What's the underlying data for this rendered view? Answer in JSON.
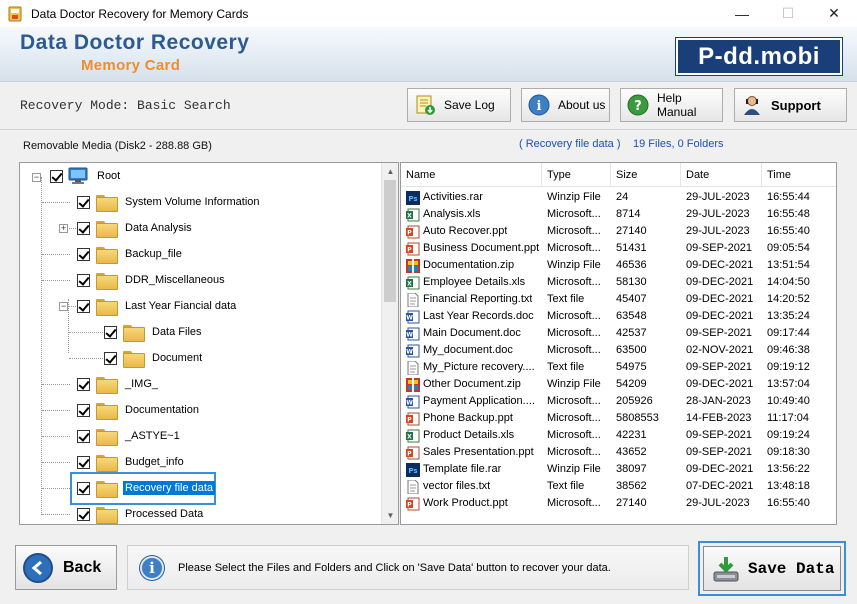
{
  "window": {
    "title": "Data Doctor Recovery for Memory Cards",
    "minimize": "—",
    "maximize": "☐",
    "close": "✕"
  },
  "header": {
    "brand_line1": "Data Doctor Recovery",
    "brand_line2": "Memory Card",
    "logo_text": "P-dd.mobi",
    "colors": {
      "brand_blue": "#2d5a8f",
      "brand_orange": "#f08c2e",
      "logo_bg": "#1a3f78"
    }
  },
  "toolbar": {
    "mode_text": "Recovery Mode: Basic Search",
    "buttons": [
      {
        "label": "Save Log",
        "icon": "save-log-icon"
      },
      {
        "label": "About us",
        "icon": "info-icon"
      },
      {
        "label": "Help Manual",
        "icon": "help-icon"
      },
      {
        "label": "Support",
        "icon": "support-person-icon"
      }
    ]
  },
  "left_panel": {
    "media_label": "Removable Media (Disk2 - 288.88 GB)",
    "tree": [
      {
        "label": "Root",
        "checked": true,
        "icon": "computer-icon"
      },
      {
        "label": "System Volume Information",
        "checked": true
      },
      {
        "label": "Data Analysis",
        "checked": true,
        "expandable": true
      },
      {
        "label": "Backup_file",
        "checked": true
      },
      {
        "label": "DDR_Miscellaneous",
        "checked": true
      },
      {
        "label": "Last Year Fiancial data",
        "checked": true,
        "expanded": true
      },
      {
        "label": "Data Files",
        "checked": true
      },
      {
        "label": "Document",
        "checked": true
      },
      {
        "label": "_IMG_",
        "checked": true
      },
      {
        "label": "Documentation",
        "checked": true
      },
      {
        "label": "_ASTYE~1",
        "checked": true
      },
      {
        "label": "Budget_info",
        "checked": true
      },
      {
        "label": "Recovery file data",
        "checked": true,
        "selected": true
      },
      {
        "label": "Processed Data",
        "checked": true
      }
    ]
  },
  "right_panel": {
    "title": "( Recovery file data )",
    "count": "19 Files, 0 Folders",
    "columns": [
      "Name",
      "Type",
      "Size",
      "Date",
      "Time"
    ],
    "rows": [
      {
        "name": "Activities.rar",
        "type": "Winzip File",
        "size": "24",
        "date": "29-JUL-2023",
        "time": "16:55:44",
        "icon": "ps"
      },
      {
        "name": "Analysis.xls",
        "type": "Microsoft...",
        "size": "8714",
        "date": "29-JUL-2023",
        "time": "16:55:48",
        "icon": "xls"
      },
      {
        "name": "Auto Recover.ppt",
        "type": "Microsoft...",
        "size": "27140",
        "date": "29-JUL-2023",
        "time": "16:55:40",
        "icon": "ppt"
      },
      {
        "name": "Business Document.ppt",
        "type": "Microsoft...",
        "size": "51431",
        "date": "09-SEP-2021",
        "time": "09:05:54",
        "icon": "ppt"
      },
      {
        "name": "Documentation.zip",
        "type": "Winzip File",
        "size": "46536",
        "date": "09-DEC-2021",
        "time": "13:51:54",
        "icon": "zip"
      },
      {
        "name": "Employee Details.xls",
        "type": "Microsoft...",
        "size": "58130",
        "date": "09-DEC-2021",
        "time": "14:04:50",
        "icon": "xls"
      },
      {
        "name": "Financial Reporting.txt",
        "type": "Text file",
        "size": "45407",
        "date": "09-DEC-2021",
        "time": "14:20:52",
        "icon": "txt"
      },
      {
        "name": "Last Year Records.doc",
        "type": "Microsoft...",
        "size": "63548",
        "date": "09-DEC-2021",
        "time": "13:35:24",
        "icon": "doc"
      },
      {
        "name": "Main Document.doc",
        "type": "Microsoft...",
        "size": "42537",
        "date": "09-SEP-2021",
        "time": "09:17:44",
        "icon": "doc"
      },
      {
        "name": "My_document.doc",
        "type": "Microsoft...",
        "size": "63500",
        "date": "02-NOV-2021",
        "time": "09:46:38",
        "icon": "doc"
      },
      {
        "name": "My_Picture recovery....",
        "type": "Text file",
        "size": "54975",
        "date": "09-SEP-2021",
        "time": "09:19:12",
        "icon": "txt"
      },
      {
        "name": "Other Document.zip",
        "type": "Winzip File",
        "size": "54209",
        "date": "09-DEC-2021",
        "time": "13:57:04",
        "icon": "zip"
      },
      {
        "name": "Payment Application....",
        "type": "Microsoft...",
        "size": "205926",
        "date": "28-JAN-2023",
        "time": "10:49:40",
        "icon": "doc"
      },
      {
        "name": "Phone Backup.ppt",
        "type": "Microsoft...",
        "size": "5808553",
        "date": "14-FEB-2023",
        "time": "11:17:04",
        "icon": "ppt"
      },
      {
        "name": "Product Details.xls",
        "type": "Microsoft...",
        "size": "42231",
        "date": "09-SEP-2021",
        "time": "09:19:24",
        "icon": "xls"
      },
      {
        "name": "Sales Presentation.ppt",
        "type": "Microsoft...",
        "size": "43652",
        "date": "09-SEP-2021",
        "time": "09:18:30",
        "icon": "ppt"
      },
      {
        "name": "Template file.rar",
        "type": "Winzip File",
        "size": "38097",
        "date": "09-DEC-2021",
        "time": "13:56:22",
        "icon": "ps"
      },
      {
        "name": "vector files.txt",
        "type": "Text file",
        "size": "38562",
        "date": "07-DEC-2021",
        "time": "13:48:18",
        "icon": "txt"
      },
      {
        "name": "Work Product.ppt",
        "type": "Microsoft...",
        "size": "27140",
        "date": "29-JUL-2023",
        "time": "16:55:40",
        "icon": "ppt"
      }
    ]
  },
  "bottom": {
    "back_label": "Back",
    "info_text": "Please Select the Files and Folders and Click on 'Save Data' button to recover your data.",
    "save_label": "Save Data"
  }
}
